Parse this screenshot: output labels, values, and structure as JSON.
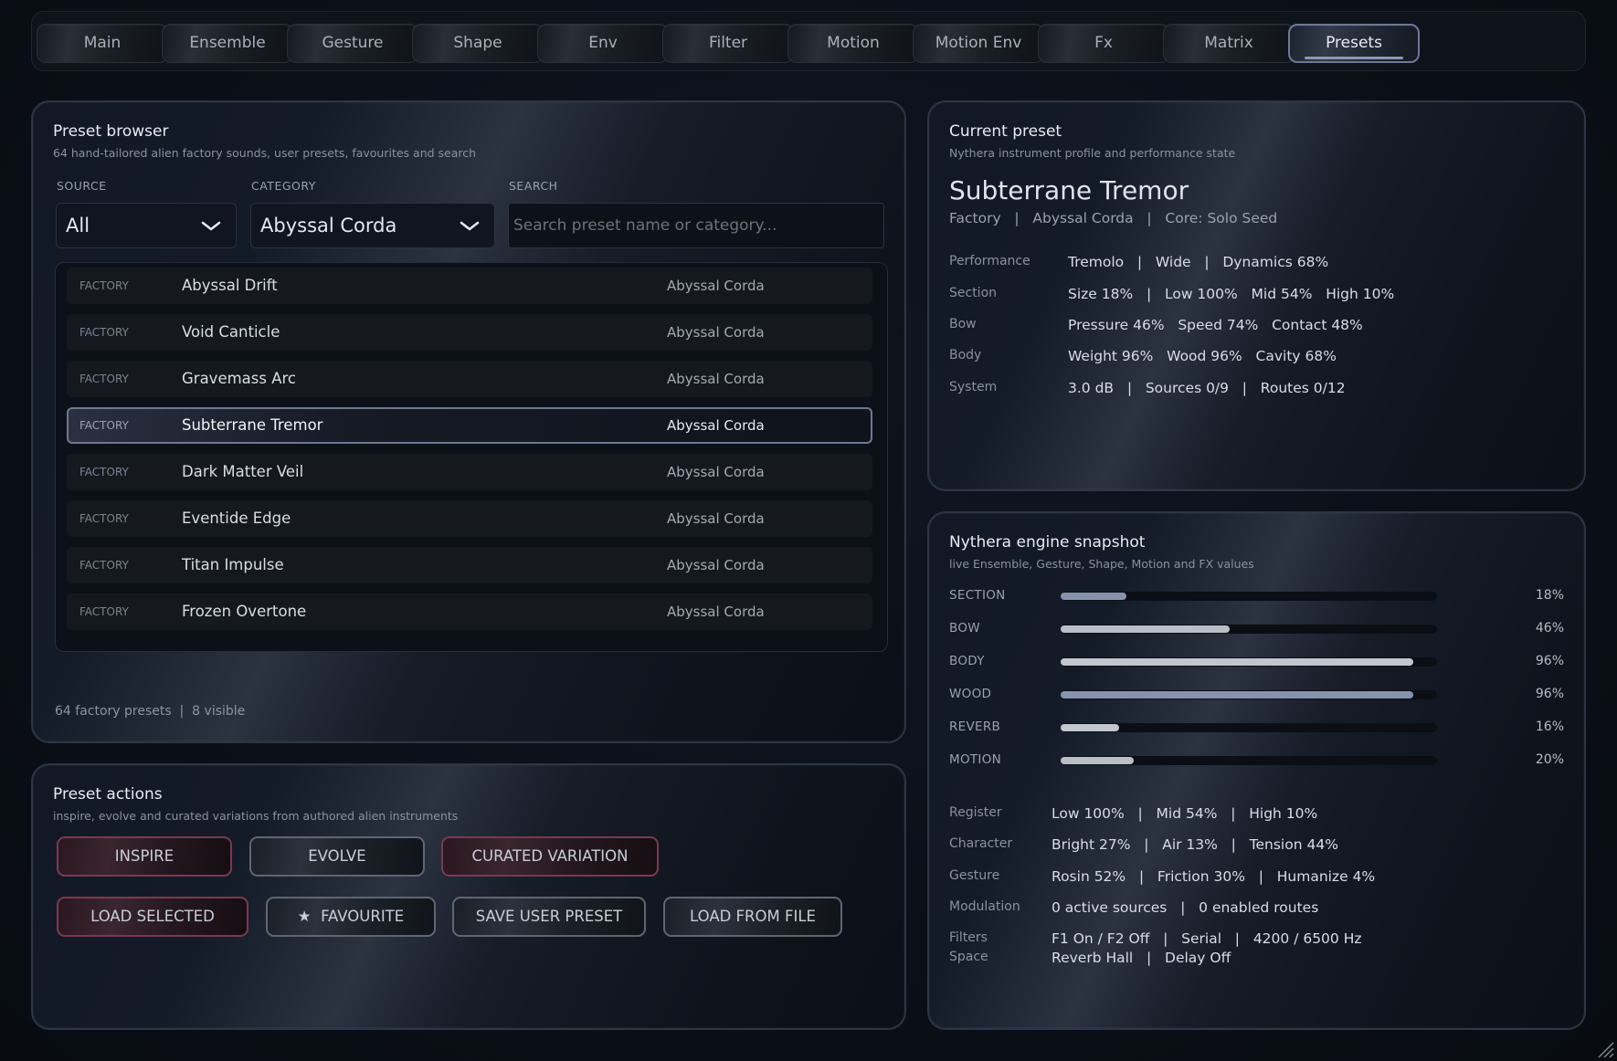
{
  "tabs": [
    {
      "label": "Main",
      "active": false
    },
    {
      "label": "Ensemble",
      "active": false
    },
    {
      "label": "Gesture",
      "active": false
    },
    {
      "label": "Shape",
      "active": false
    },
    {
      "label": "Env",
      "active": false
    },
    {
      "label": "Filter",
      "active": false
    },
    {
      "label": "Motion",
      "active": false
    },
    {
      "label": "Motion Env",
      "active": false
    },
    {
      "label": "Fx",
      "active": false
    },
    {
      "label": "Matrix",
      "active": false
    },
    {
      "label": "Presets",
      "active": true
    }
  ],
  "browser": {
    "title": "Preset browser",
    "subtitle": "64 hand-tailored alien factory sounds, user presets, favourites and search",
    "source_label": "SOURCE",
    "source_value": "All",
    "category_label": "CATEGORY",
    "category_value": "Abyssal Corda",
    "search_label": "SEARCH",
    "search_placeholder": "Search preset name or category...",
    "search_value": "",
    "rows": [
      {
        "source": "FACTORY",
        "name": "Abyssal Drift",
        "category": "Abyssal Corda",
        "selected": false
      },
      {
        "source": "FACTORY",
        "name": "Void Canticle",
        "category": "Abyssal Corda",
        "selected": false
      },
      {
        "source": "FACTORY",
        "name": "Gravemass Arc",
        "category": "Abyssal Corda",
        "selected": false
      },
      {
        "source": "FACTORY",
        "name": "Subterrane Tremor",
        "category": "Abyssal Corda",
        "selected": true
      },
      {
        "source": "FACTORY",
        "name": "Dark Matter Veil",
        "category": "Abyssal Corda",
        "selected": false
      },
      {
        "source": "FACTORY",
        "name": "Eventide Edge",
        "category": "Abyssal Corda",
        "selected": false
      },
      {
        "source": "FACTORY",
        "name": "Titan Impulse",
        "category": "Abyssal Corda",
        "selected": false
      },
      {
        "source": "FACTORY",
        "name": "Frozen Overtone",
        "category": "Abyssal Corda",
        "selected": false
      }
    ],
    "footer": "64 factory presets  |  8 visible"
  },
  "actions": {
    "title": "Preset actions",
    "subtitle": "inspire, evolve and curated variations from authored alien instruments",
    "inspire": "INSPIRE",
    "evolve": "EVOLVE",
    "curated": "CURATED VARIATION",
    "load_selected": "LOAD SELECTED",
    "favourite": "★  FAVOURITE",
    "save_user": "SAVE USER PRESET",
    "load_file": "LOAD FROM FILE"
  },
  "current": {
    "title": "Current preset",
    "subtitle": "Nythera instrument profile and performance state",
    "name": "Subterrane Tremor",
    "meta": "Factory   |   Abyssal Corda   |   Core: Solo Seed",
    "rows": [
      {
        "label": "Performance",
        "value": "Tremolo   |   Wide   |   Dynamics 68%"
      },
      {
        "label": "Section",
        "value": "Size 18%   |   Low 100%   Mid 54%   High 10%"
      },
      {
        "label": "Bow",
        "value": "Pressure 46%   Speed 74%   Contact 48%"
      },
      {
        "label": "Body",
        "value": "Weight 96%   Wood 96%   Cavity 68%"
      },
      {
        "label": "System",
        "value": "3.0 dB   |   Sources 0/9   |   Routes 0/12"
      }
    ]
  },
  "snapshot": {
    "title": "Nythera engine snapshot",
    "subtitle": "live Ensemble, Gesture, Shape, Motion and FX values",
    "bars": [
      {
        "label": "SECTION",
        "value": 0.18,
        "pct": "18%",
        "color": "#8793ad"
      },
      {
        "label": "BOW",
        "value": 0.46,
        "pct": "46%",
        "color": "#b9bec8"
      },
      {
        "label": "BODY",
        "value": 0.96,
        "pct": "96%",
        "color": "#c2c6cf"
      },
      {
        "label": "WOOD",
        "value": 0.96,
        "pct": "96%",
        "color": "#8793ad"
      },
      {
        "label": "REVERB",
        "value": 0.16,
        "pct": "16%",
        "color": "#c2c6cf"
      },
      {
        "label": "MOTION",
        "value": 0.2,
        "pct": "20%",
        "color": "#b9bec8"
      }
    ],
    "rows": [
      {
        "label": "Register",
        "value": "Low 100%   |   Mid 54%   |   High 10%"
      },
      {
        "label": "Character",
        "value": "Bright 27%   |   Air 13%   |   Tension 44%"
      },
      {
        "label": "Gesture",
        "value": "Rosin 52%   |   Friction 30%   |   Humanize 4%"
      },
      {
        "label": "Modulation",
        "value": "0 active sources   |   0 enabled routes"
      }
    ],
    "filters_label": "Filters",
    "filters_value": "F1 On / F2 Off   |   Serial   |   4200 / 6500 Hz",
    "space_label": "Space",
    "space_value": "Reverb Hall   |   Delay Off"
  }
}
